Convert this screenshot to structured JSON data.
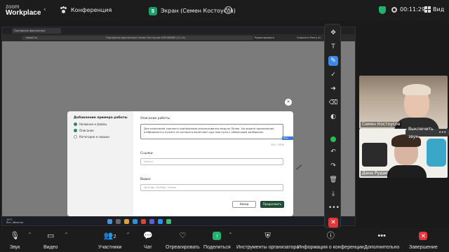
{
  "top": {
    "logo_line1": "zoom",
    "logo_line2": "Workplace",
    "conference_label": "Конференция",
    "screen_label": "Экран (Семен Костоусов)",
    "screen_badge": "S",
    "timer": "00:11:29",
    "view_label": "Вид"
  },
  "browser": {
    "tab_title": "Портфолио фрилансера",
    "url": "www.fl.ru",
    "page_title": "Портфолио фрилансера Семен Костоусов $2R3G88B9 [11-2L]",
    "bookmark1": "Редактировать",
    "bookmark2": "Спросить Кэнгу AI"
  },
  "modal": {
    "side_title": "Добавление примера работы",
    "steps": [
      {
        "label": "Название и файлы",
        "state": "done"
      },
      {
        "label": "Описание",
        "state": "done"
      },
      {
        "label": "Категория и навыки",
        "state": "pending"
      }
    ],
    "description_label": "Описание работы",
    "description_value": "Для написания сканного приложения использовался модуль Поляк. На экране приложения отображается лужнет из которого вылетают круглые пули с небольшим разбросом.",
    "counter": "152 / 1500",
    "cursor_tag": "Ваш Кадик",
    "links_label": "Ссылки",
    "links_placeholder": "https://",
    "video_label": "Видео",
    "video_placeholder": "YouTube, RuTube, Vimeo",
    "back_button": "Назад",
    "next_button": "Продолжить",
    "close": "×"
  },
  "taskbar": {
    "weather_temp": "19°C",
    "weather_desc": "Ясн, облачно"
  },
  "videos": {
    "participant1": "Семен Костоусов",
    "participant2": "Дана Рудак",
    "mute_tip": "Выключить звук"
  },
  "bottom": {
    "audio": "Звук",
    "video": "Видео",
    "participants": "Участники",
    "participants_count": "2",
    "chat": "Чат",
    "react": "Отреагировать",
    "share": "Поделиться",
    "host_tools": "Инструменты организатора",
    "info": "Информация о конференции",
    "more": "Дополнительно",
    "end": "Завершение"
  },
  "icons": [
    "paw-icon",
    "shield-icon",
    "grid-icon",
    "pen-icon",
    "arrow-icon",
    "eraser-icon",
    "undo-icon",
    "redo-icon",
    "save-icon",
    "close-icon",
    "mic-icon",
    "camera-icon",
    "people-icon",
    "chat-icon",
    "heart-icon",
    "share-icon",
    "shield-tools-icon",
    "info-icon",
    "more-icon"
  ],
  "colors": {
    "accent_blue": "#3c8ae8",
    "green": "#23b26d",
    "red": "#e5373a",
    "dark_green_btn": "#1f4d33"
  }
}
